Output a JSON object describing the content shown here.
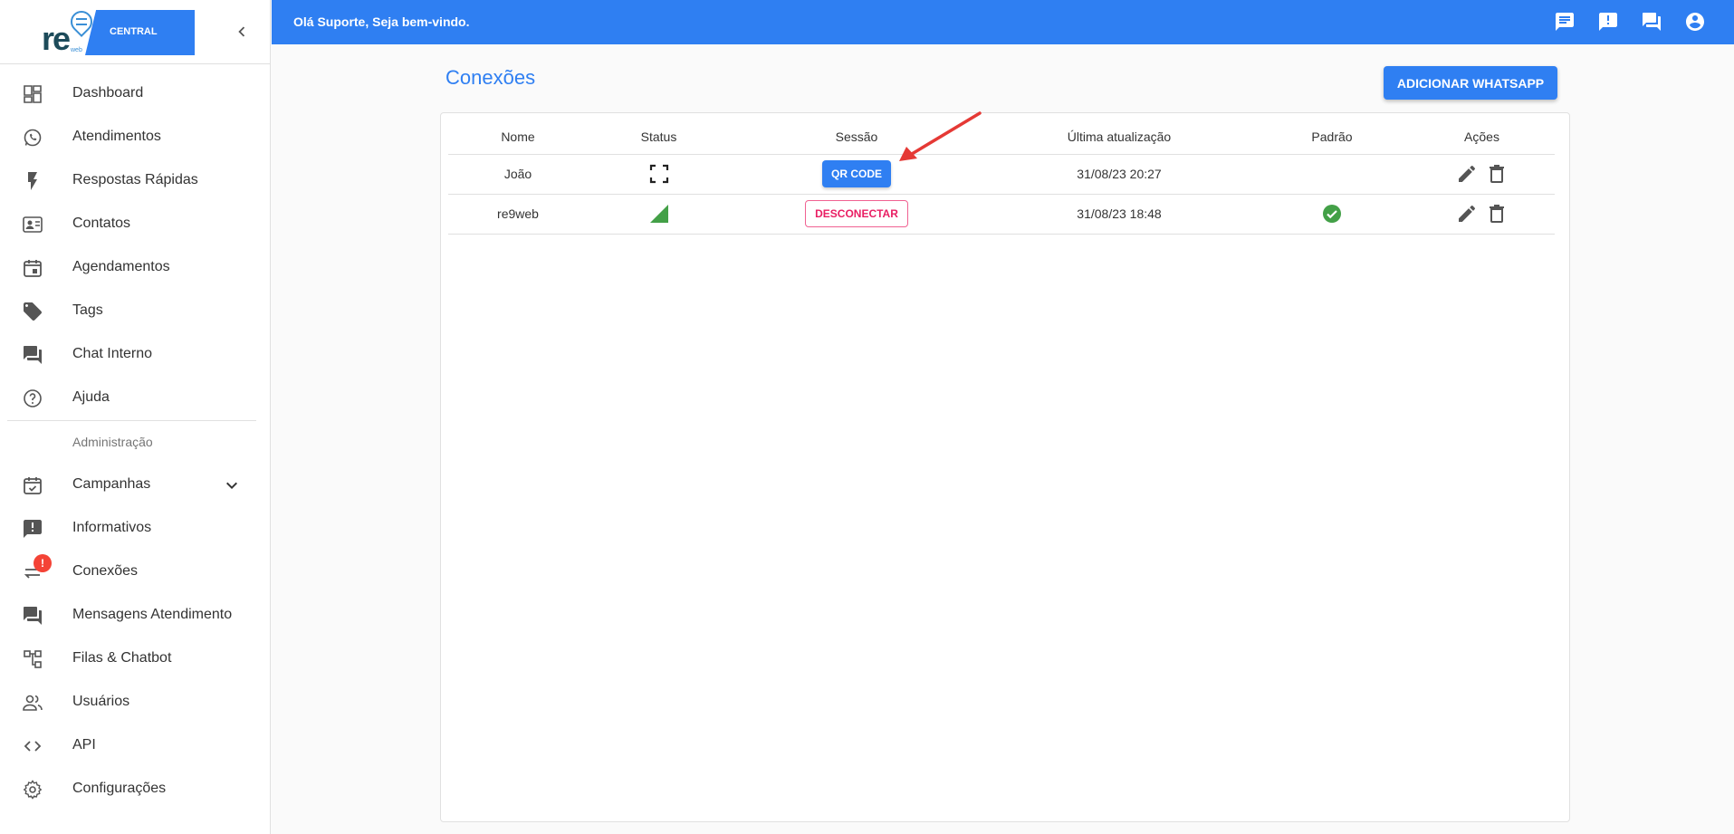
{
  "brand": {
    "logo_text": "re",
    "logo_subtext": "web",
    "banner": "CENTRAL"
  },
  "topbar": {
    "greeting": "Olá Suporte, Seja bem-vindo."
  },
  "sidebar": {
    "items": [
      {
        "label": "Dashboard",
        "icon": "dashboard-icon"
      },
      {
        "label": "Atendimentos",
        "icon": "whatsapp-icon"
      },
      {
        "label": "Respostas Rápidas",
        "icon": "flash-icon"
      },
      {
        "label": "Contatos",
        "icon": "contact-card-icon"
      },
      {
        "label": "Agendamentos",
        "icon": "calendar-icon"
      },
      {
        "label": "Tags",
        "icon": "tag-icon"
      },
      {
        "label": "Chat Interno",
        "icon": "forum-icon"
      },
      {
        "label": "Ajuda",
        "icon": "help-icon"
      }
    ],
    "admin_header": "Administração",
    "admin_items": [
      {
        "label": "Campanhas",
        "icon": "event-check-icon"
      },
      {
        "label": "Informativos",
        "icon": "announcement-icon"
      },
      {
        "label": "Conexões",
        "icon": "sync-alt-icon",
        "badge": "!"
      },
      {
        "label": "Mensagens Atendimento",
        "icon": "chat-icon"
      },
      {
        "label": "Filas & Chatbot",
        "icon": "account-tree-icon"
      },
      {
        "label": "Usuários",
        "icon": "people-icon"
      },
      {
        "label": "API",
        "icon": "code-icon"
      },
      {
        "label": "Configurações",
        "icon": "settings-icon"
      }
    ]
  },
  "main": {
    "title": "Conexões",
    "add_button": "ADICIONAR WHATSAPP",
    "table": {
      "headers": [
        "Nome",
        "Status",
        "Sessão",
        "Última atualização",
        "Padrão",
        "Ações"
      ],
      "rows": [
        {
          "name": "João",
          "status": "qr-scan-icon",
          "session": "QR CODE",
          "updated": "31/08/23 20:27",
          "default": false
        },
        {
          "name": "re9web",
          "status": "signal-icon",
          "session": "DESCONECTAR",
          "updated": "31/08/23 18:48",
          "default": true
        }
      ]
    }
  },
  "colors": {
    "primary": "#2f7ff2",
    "danger": "#e91e63",
    "success": "#43a047",
    "badge": "#f44336",
    "annotation": "#e53935"
  }
}
